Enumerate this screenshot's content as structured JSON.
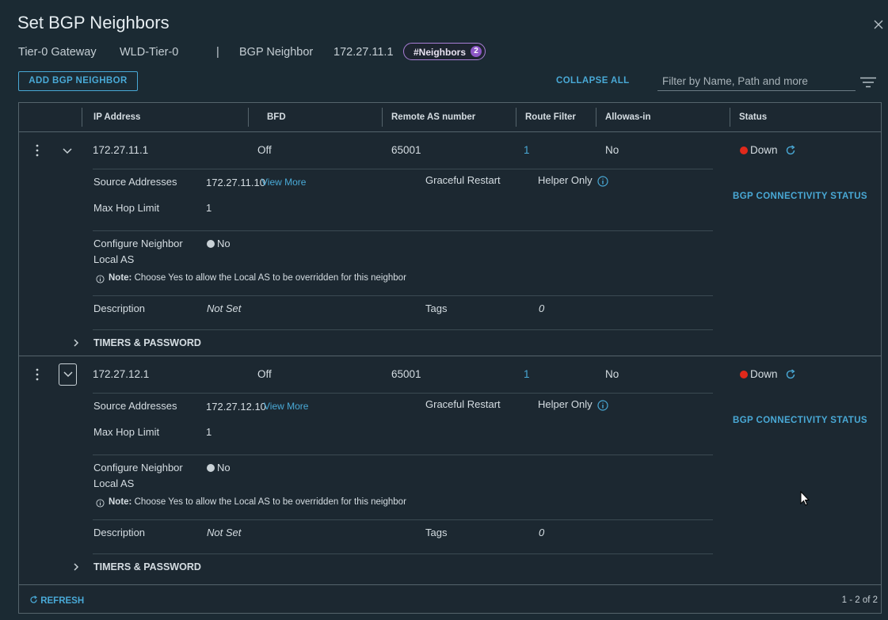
{
  "modal": {
    "title": "Set BGP Neighbors",
    "close_icon": "close-icon"
  },
  "subheader": {
    "gateway_label": "Tier-0 Gateway",
    "gateway_value": "WLD-Tier-0",
    "divider": "|",
    "neighbor_label": "BGP Neighbor",
    "neighbor_value": "172.27.11.1",
    "badge_label": "#Neighbors",
    "badge_count": "2",
    "badge_color": "#8c57c6"
  },
  "toolbar": {
    "add_label": "ADD BGP NEIGHBOR",
    "collapse_all_label": "COLLAPSE ALL",
    "filter_placeholder": "Filter by Name, Path and more",
    "filter_icon": "filter-icon"
  },
  "columns": [
    "IP Address",
    "BFD",
    "Remote AS number",
    "Route Filter",
    "Allowas-in",
    "Status"
  ],
  "labels": {
    "source_addresses": "Source Addresses",
    "max_hop_limit": "Max Hop Limit",
    "graceful_restart": "Graceful Restart",
    "configure_neighbor_line1": "Configure Neighbor",
    "configure_neighbor_line2": "Local AS",
    "note_bold": "Note:",
    "note_text": "Choose Yes to allow the Local AS to be overridden for this neighbor",
    "description": "Description",
    "tags": "Tags",
    "view_more": "View More",
    "bgp_connectivity_status": "BGP CONNECTIVITY STATUS",
    "timers_password": "TIMERS & PASSWORD"
  },
  "neighbors": [
    {
      "ip": "172.27.11.1",
      "bfd": "Off",
      "remote_as": "65001",
      "route_filter": "1",
      "allowas_in": "No",
      "status": "Down",
      "status_color": "#e0291b",
      "source_address": "172.27.11.10",
      "max_hop_limit": "1",
      "graceful_restart": "Helper Only",
      "local_as": "No",
      "description": "Not Set",
      "tags": "0"
    },
    {
      "ip": "172.27.12.1",
      "bfd": "Off",
      "remote_as": "65001",
      "route_filter": "1",
      "allowas_in": "No",
      "status": "Down",
      "status_color": "#e0291b",
      "source_address": "172.27.12.10",
      "max_hop_limit": "1",
      "graceful_restart": "Helper Only",
      "local_as": "No",
      "description": "Not Set",
      "tags": "0"
    }
  ],
  "footer": {
    "refresh_label": "REFRESH",
    "pagination": "1 - 2 of 2"
  },
  "colors": {
    "accent": "#49a9d6",
    "background": "#1b2a33",
    "status_down": "#e0291b"
  }
}
